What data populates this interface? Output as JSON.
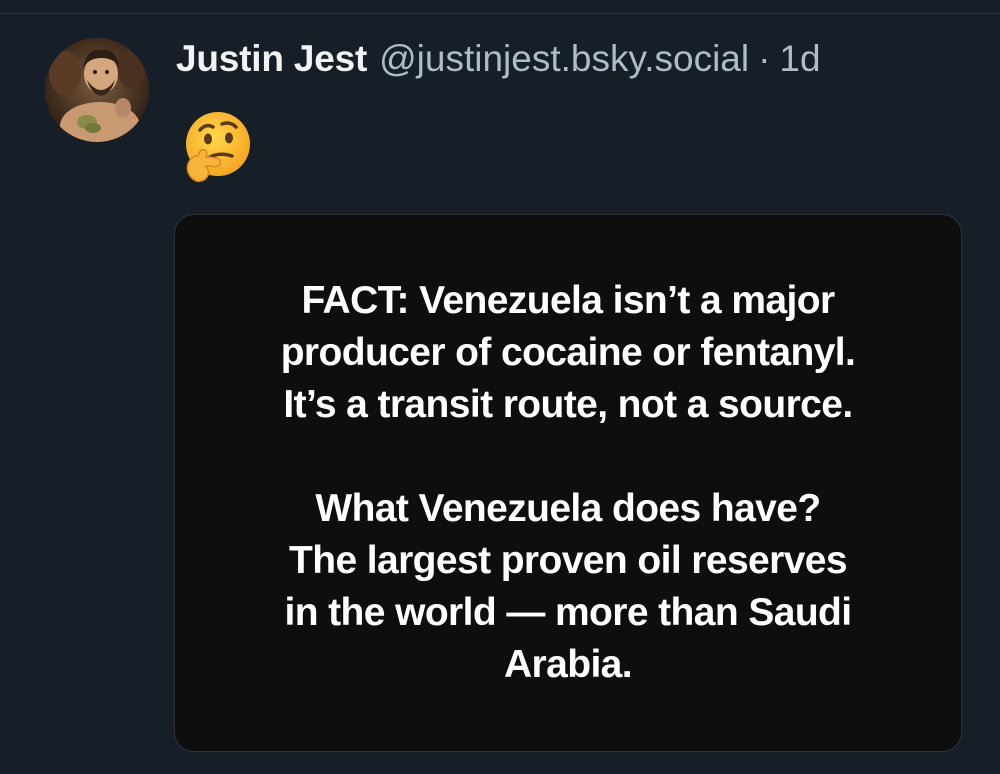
{
  "post": {
    "author_name": "Justin Jest",
    "handle": "@justinjest.bsky.social",
    "separator": "·",
    "timestamp": "1d",
    "emoji_icon": "thinking-face-icon",
    "embed": {
      "paragraph_1_lines": [
        "FACT: Venezuela isn’t a major",
        "producer of cocaine or fentanyl.",
        "It’s a transit route, not a source."
      ],
      "paragraph_2_lines": [
        "What Venezuela does have?",
        "The largest proven oil reserves",
        "in the world — more than Saudi",
        "Arabia."
      ]
    }
  },
  "colors": {
    "background": "#161e27",
    "name": "#f1f3f5",
    "meta": "#aebbc9",
    "embed_background": "#0e0e0e",
    "embed_text": "#ffffff"
  }
}
